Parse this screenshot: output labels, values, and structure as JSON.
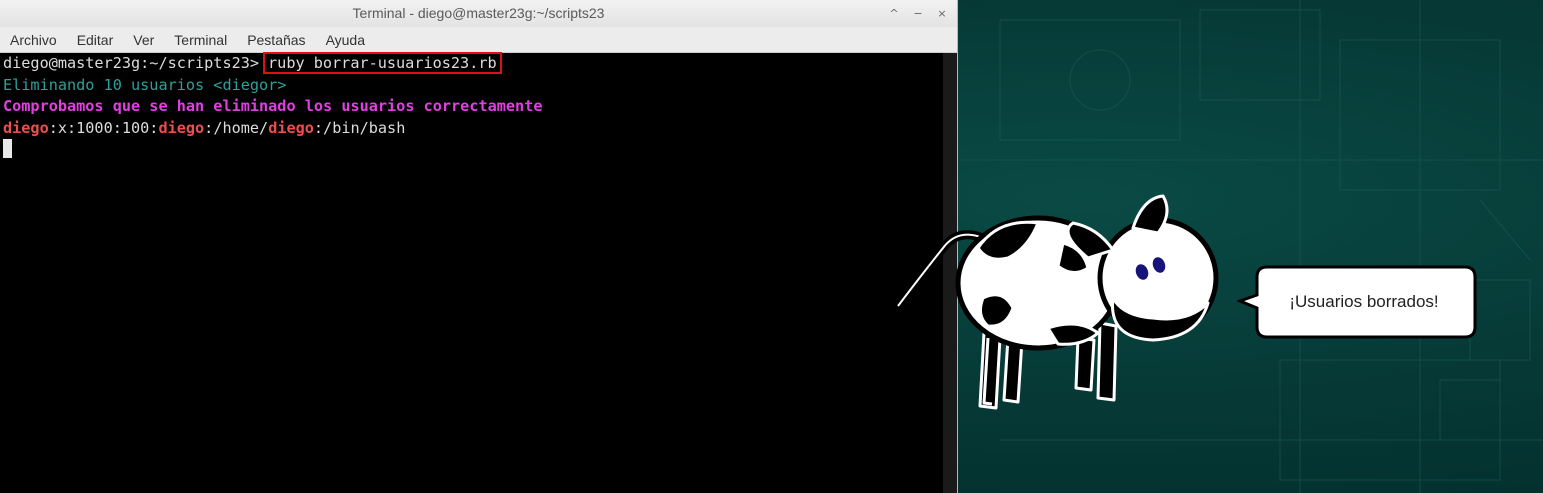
{
  "window": {
    "title": "Terminal - diego@master23g:~/scripts23",
    "buttons": [
      "^",
      "−",
      "×"
    ]
  },
  "menu": [
    "Archivo",
    "Editar",
    "Ver",
    "Terminal",
    "Pestañas",
    "Ayuda"
  ],
  "terminal": {
    "prompt": "diego@master23g:~/scripts23>",
    "command": "ruby borrar-usuarios23.rb",
    "line2": "Eliminando 10 usuarios <diegor>",
    "line3": "Comprobamos que se han eliminado los usuarios correctamente",
    "line4_parts": [
      "diego",
      ":x:1000:100:",
      "diego",
      ":/home/",
      "diego",
      ":/bin/bash"
    ]
  },
  "cow_bubble": "¡Usuarios borrados!",
  "colors": {
    "highlight_box": "#e01010",
    "cyan_text": "#2aa19a",
    "magenta_text": "#e040e0",
    "red_text": "#ee4e4e"
  }
}
